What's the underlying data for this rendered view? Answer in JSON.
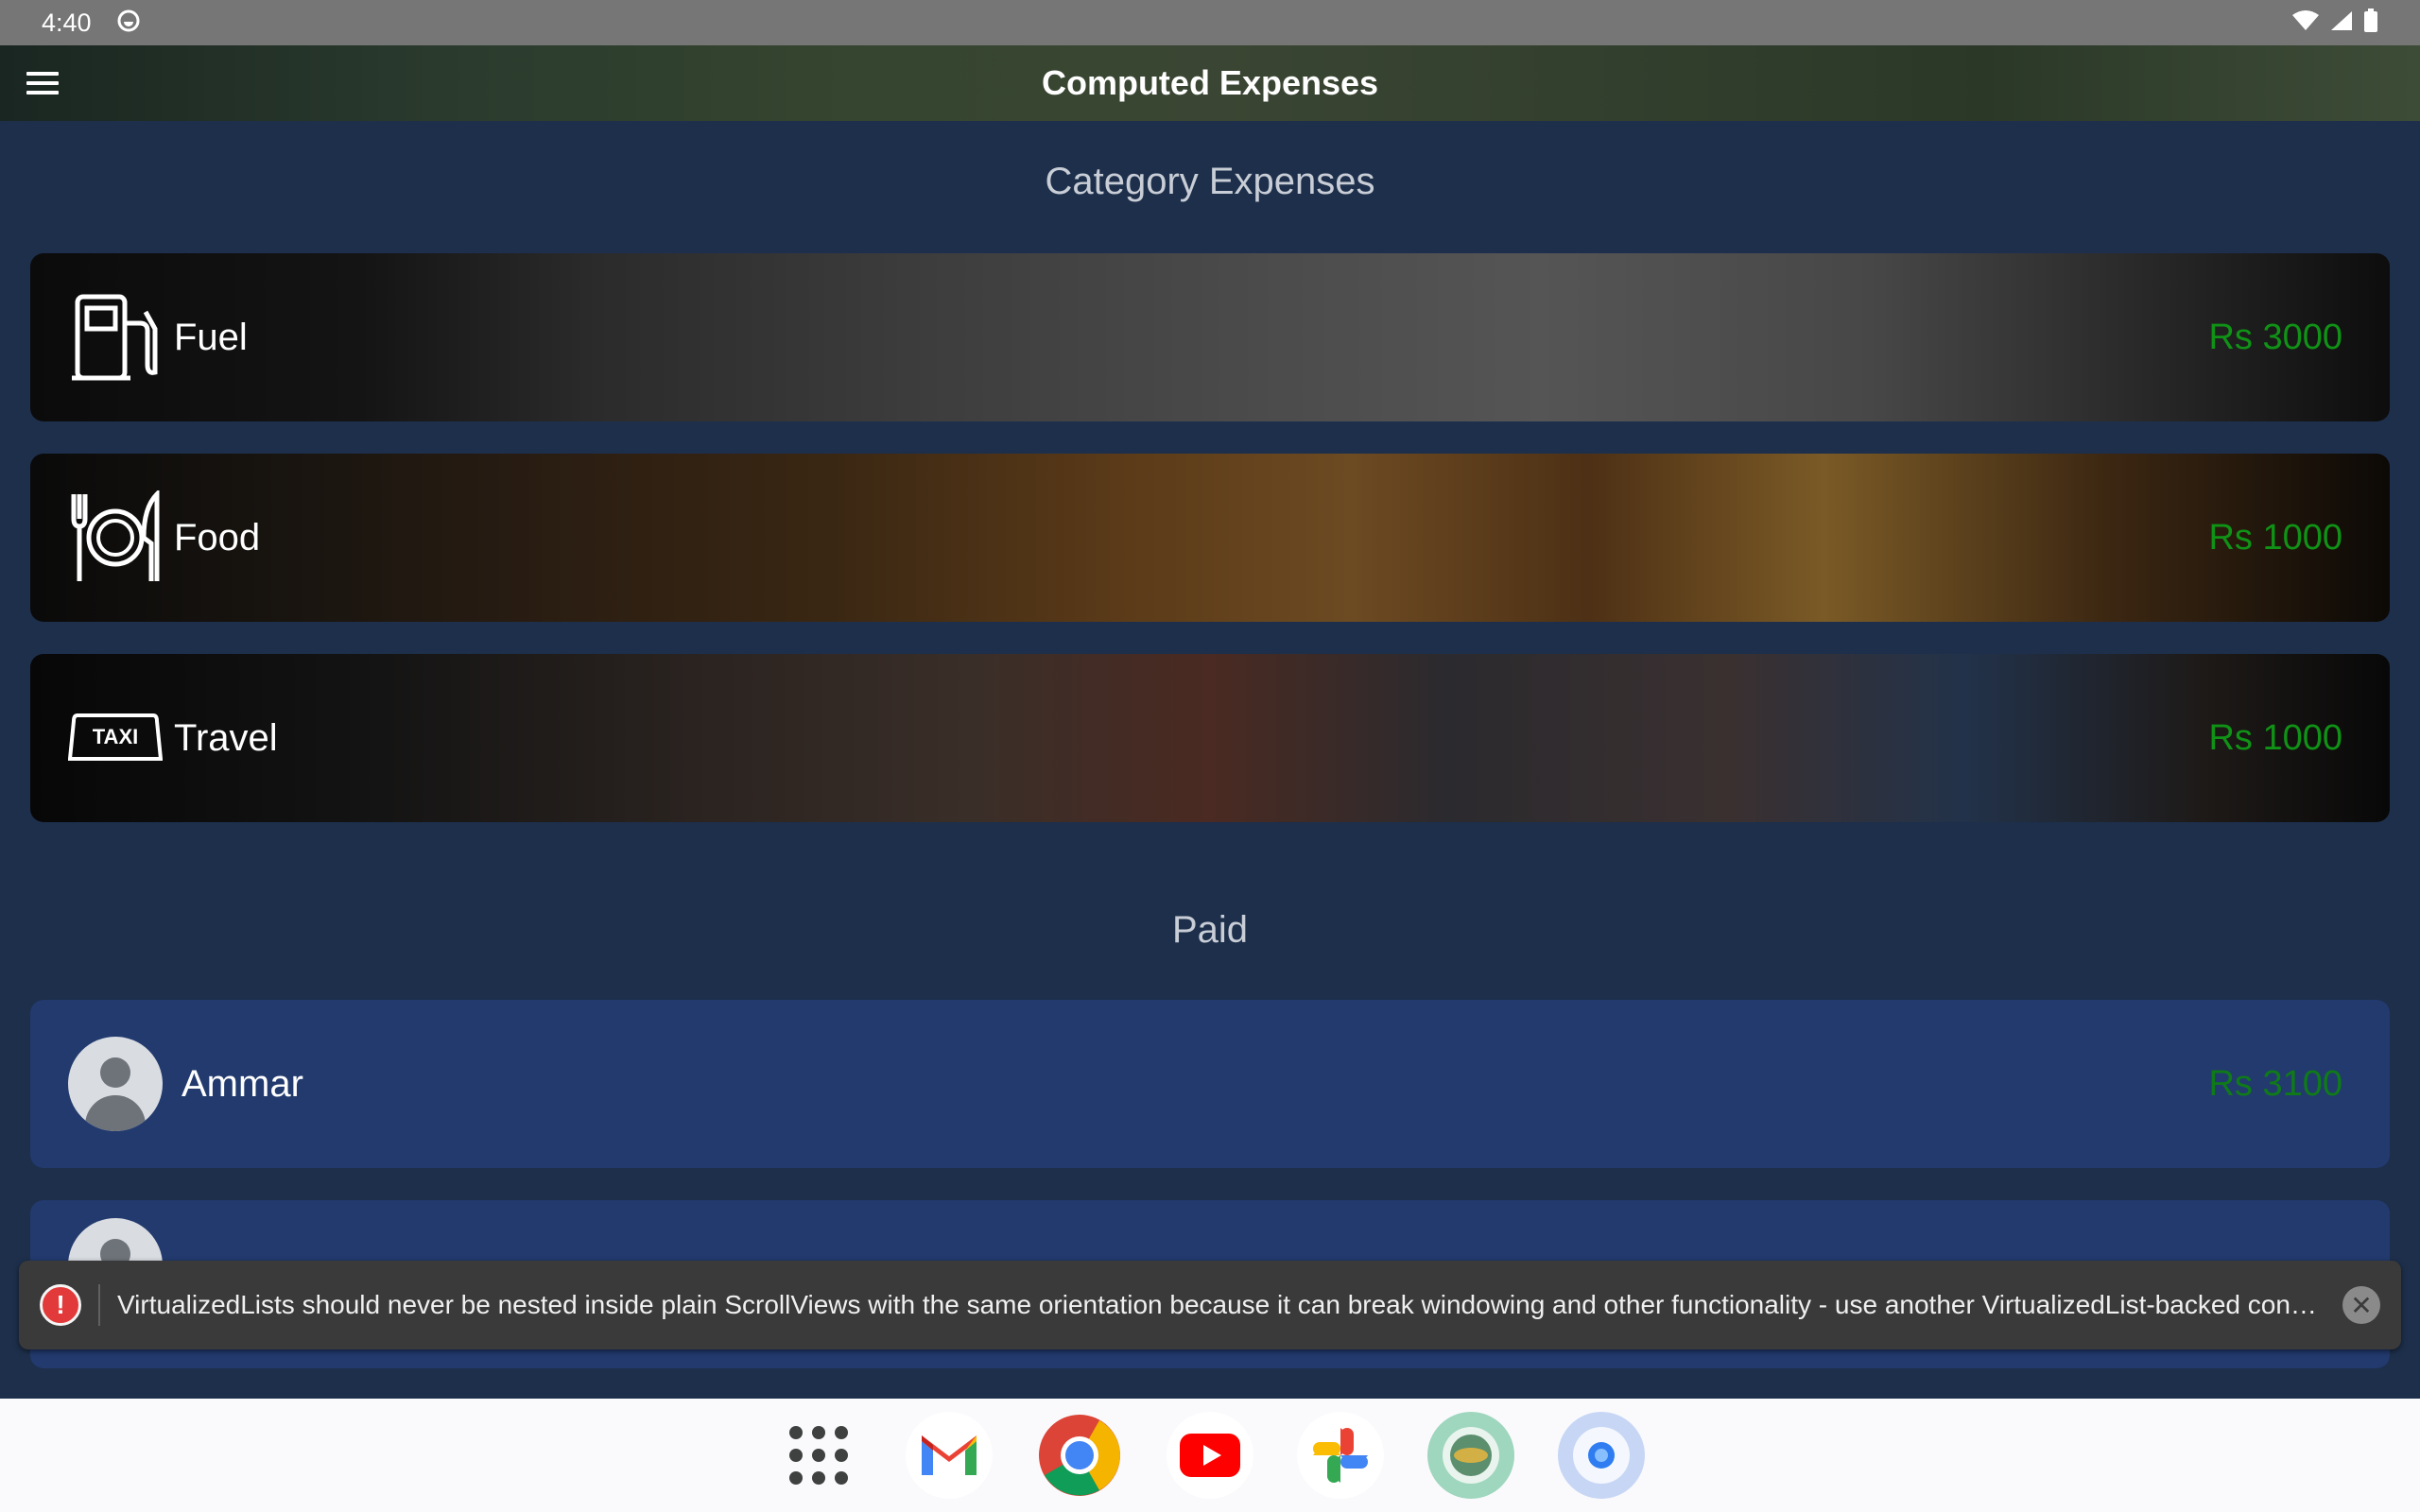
{
  "status_bar": {
    "time": "4:40",
    "icons": [
      "sync-icon",
      "wifi-icon",
      "signal-icon",
      "battery-icon"
    ]
  },
  "app_bar": {
    "title": "Computed Expenses",
    "menu_icon": "hamburger-menu-icon"
  },
  "category_section": {
    "title": "Category Expenses",
    "items": [
      {
        "label": "Fuel",
        "amount": "Rs 3000",
        "icon": "fuel-pump-icon"
      },
      {
        "label": "Food",
        "amount": "Rs 1000",
        "icon": "plate-utensils-icon"
      },
      {
        "label": "Travel",
        "amount": "Rs 1000",
        "icon": "taxi-icon",
        "icon_text": "TAXI"
      }
    ]
  },
  "paid_section": {
    "title": "Paid",
    "items": [
      {
        "label": "Ammar",
        "amount": "Rs 3100",
        "icon": "avatar-icon"
      }
    ]
  },
  "warning": {
    "message": "VirtualizedLists should never be nested inside plain ScrollViews with the same orientation because it can break windowing and other functionality - use another VirtualizedList-backed conta...",
    "icon": "error-icon",
    "close_icon": "close-icon"
  },
  "dock": {
    "apps": [
      "app-drawer-icon",
      "gmail-icon",
      "chrome-icon",
      "youtube-icon",
      "photos-icon",
      "app-icon",
      "camera-icon"
    ]
  },
  "colors": {
    "background": "#1d2f4b",
    "amount_green": "#109216",
    "paid_card": "#223a6e"
  }
}
